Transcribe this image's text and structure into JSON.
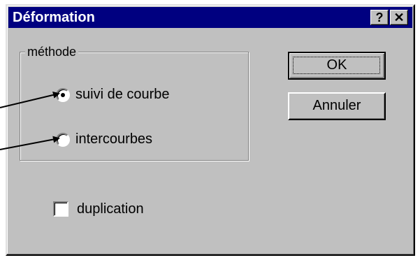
{
  "dialog": {
    "title": "Déformation",
    "help_button": "?",
    "close_button": "✕"
  },
  "method_group": {
    "label": "méthode",
    "options": [
      {
        "label": "suivi de courbe",
        "checked": true
      },
      {
        "label": "intercourbes",
        "checked": false
      }
    ]
  },
  "duplication": {
    "label": "duplication",
    "checked": false
  },
  "buttons": {
    "ok": "OK",
    "cancel": "Annuler"
  },
  "colors": {
    "titlebar": "#000080",
    "face": "#c0c0c0"
  }
}
